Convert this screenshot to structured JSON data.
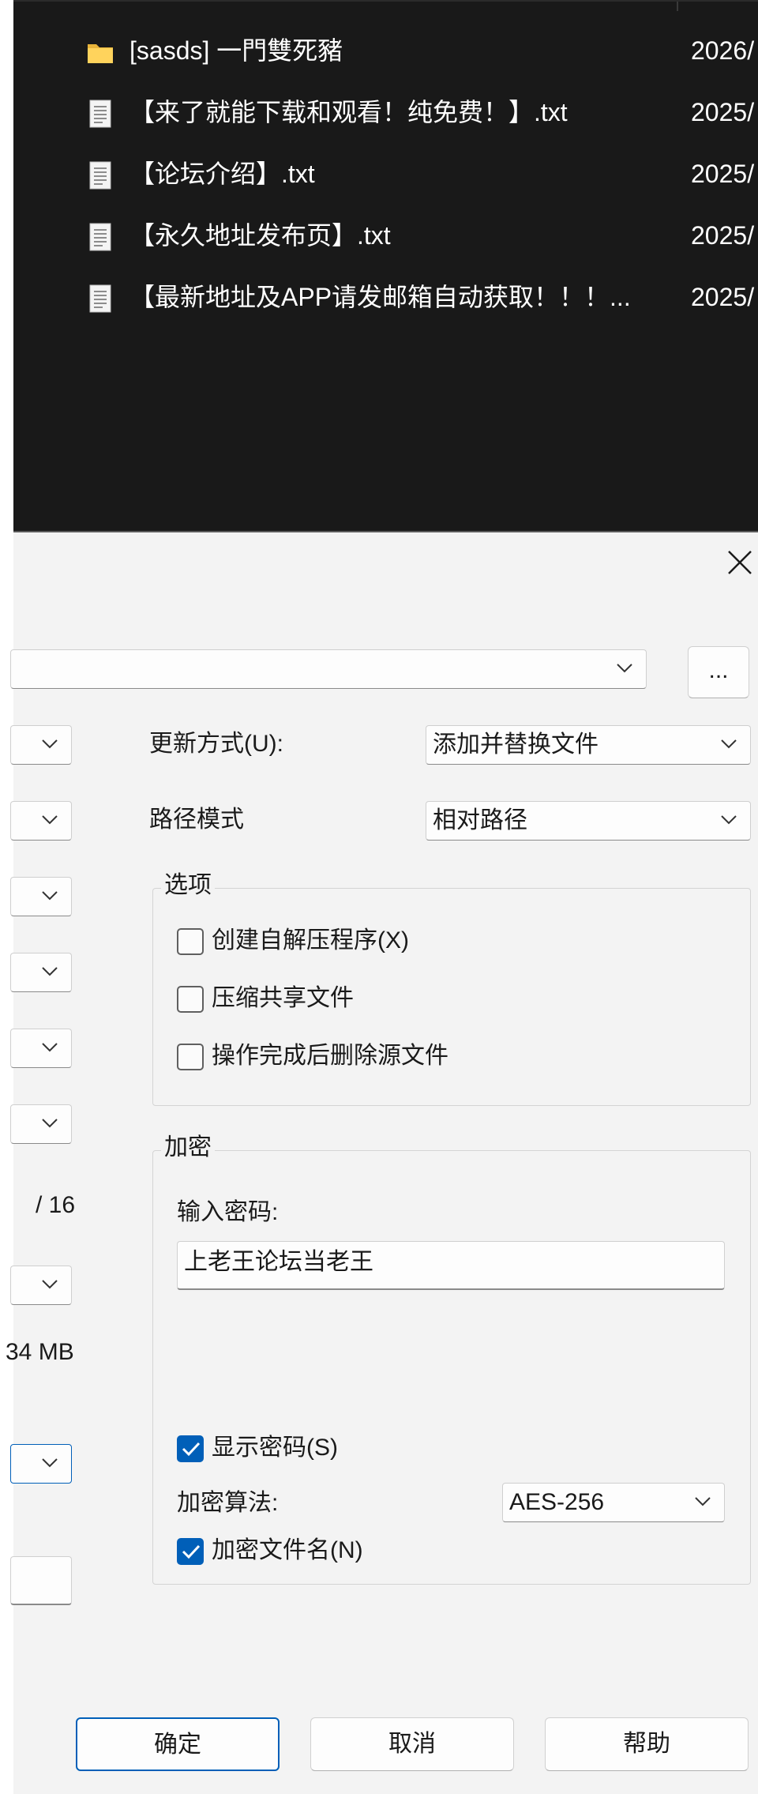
{
  "explorer": {
    "files": [
      {
        "icon": "folder-icon",
        "name": "[sasds] 一門雙死豬",
        "date": "2026/"
      },
      {
        "icon": "text-file-icon",
        "name": "【来了就能下载和观看！纯免费！】.txt",
        "date": "2025/"
      },
      {
        "icon": "text-file-icon",
        "name": "【论坛介绍】.txt",
        "date": "2025/"
      },
      {
        "icon": "text-file-icon",
        "name": "【永久地址发布页】.txt",
        "date": "2025/"
      },
      {
        "icon": "text-file-icon",
        "name": "【最新地址及APP请发邮箱自动获取！！！...",
        "date": "2025/"
      }
    ]
  },
  "dialog": {
    "close_icon": "close-icon",
    "archive_path": {
      "value": "",
      "browse_label": "..."
    },
    "left_partial": {
      "volume_suffix": "/ 16",
      "size_suffix": "34 MB"
    },
    "update_mode": {
      "label": "更新方式(U):",
      "value": "添加并替换文件"
    },
    "path_mode": {
      "label": "路径模式",
      "value": "相对路径"
    },
    "options": {
      "title": "选项",
      "items": [
        {
          "label": "创建自解压程序(X)",
          "checked": false
        },
        {
          "label": "压缩共享文件",
          "checked": false
        },
        {
          "label": "操作完成后删除源文件",
          "checked": false
        }
      ]
    },
    "encryption": {
      "title": "加密",
      "password_label": "输入密码:",
      "password_value": "上老王论坛当老王",
      "show_password": {
        "label": "显示密码(S)",
        "checked": true
      },
      "method_label": "加密算法:",
      "method_value": "AES-256",
      "encrypt_names": {
        "label": "加密文件名(N)",
        "checked": true
      }
    },
    "buttons": {
      "ok": "确定",
      "cancel": "取消",
      "help": "帮助"
    },
    "colors": {
      "accent": "#005fb8",
      "dialog_bg": "#f3f3f3",
      "explorer_bg": "#191919"
    }
  }
}
